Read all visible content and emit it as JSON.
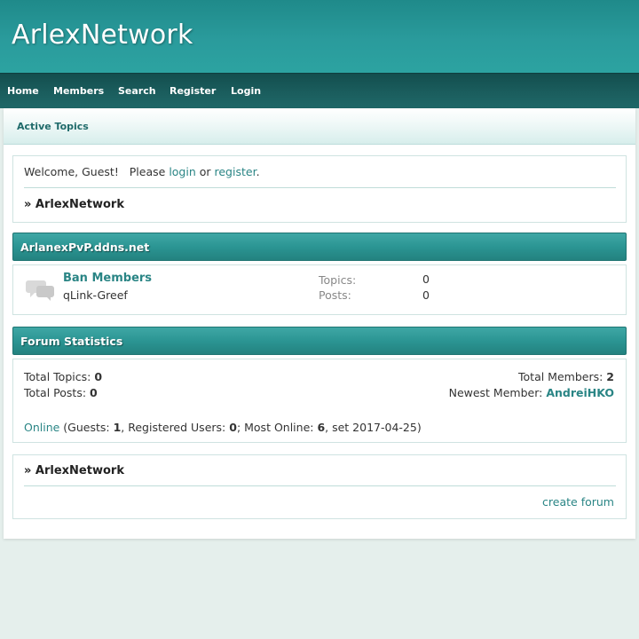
{
  "site": {
    "title": "ArlexNetwork"
  },
  "nav": {
    "items": [
      "Home",
      "Members",
      "Search",
      "Register",
      "Login"
    ]
  },
  "subbar": {
    "active_topics": "Active Topics"
  },
  "welcome": {
    "prefix": "Welcome, Guest!   Please ",
    "login": "login",
    "or": " or ",
    "register": "register",
    "suffix": ".",
    "breadcrumb": "» ArlexNetwork"
  },
  "category": {
    "title": "ArlanexPvP.ddns.net",
    "forums": [
      {
        "name": "Ban Members",
        "description": "qLink-Greef",
        "topics_label": "Topics:",
        "topics": "0",
        "posts_label": "Posts:",
        "posts": "0"
      }
    ]
  },
  "stats": {
    "title": "Forum Statistics",
    "total_topics_label": "Total Topics: ",
    "total_topics": "0",
    "total_posts_label": "Total Posts: ",
    "total_posts": "0",
    "total_members_label": "Total Members: ",
    "total_members": "2",
    "newest_member_label": "Newest Member: ",
    "newest_member": "AndreiHKO",
    "online_link": "Online",
    "online_guests_label": " (Guests: ",
    "online_guests": "1",
    "online_registered_label": ", Registered Users: ",
    "online_registered": "0",
    "online_most_label": "; Most Online: ",
    "online_most": "6",
    "online_most_date": ", set 2017-04-25)"
  },
  "footer": {
    "breadcrumb": "» ArlexNetwork",
    "create_forum": "create forum"
  },
  "colors": {
    "header": "#2a9b9c",
    "nav": "#1a5c5c",
    "link": "#2a8585",
    "background": "#e5efec"
  },
  "icons": {
    "forum_icon": "chat-bubbles-icon"
  }
}
